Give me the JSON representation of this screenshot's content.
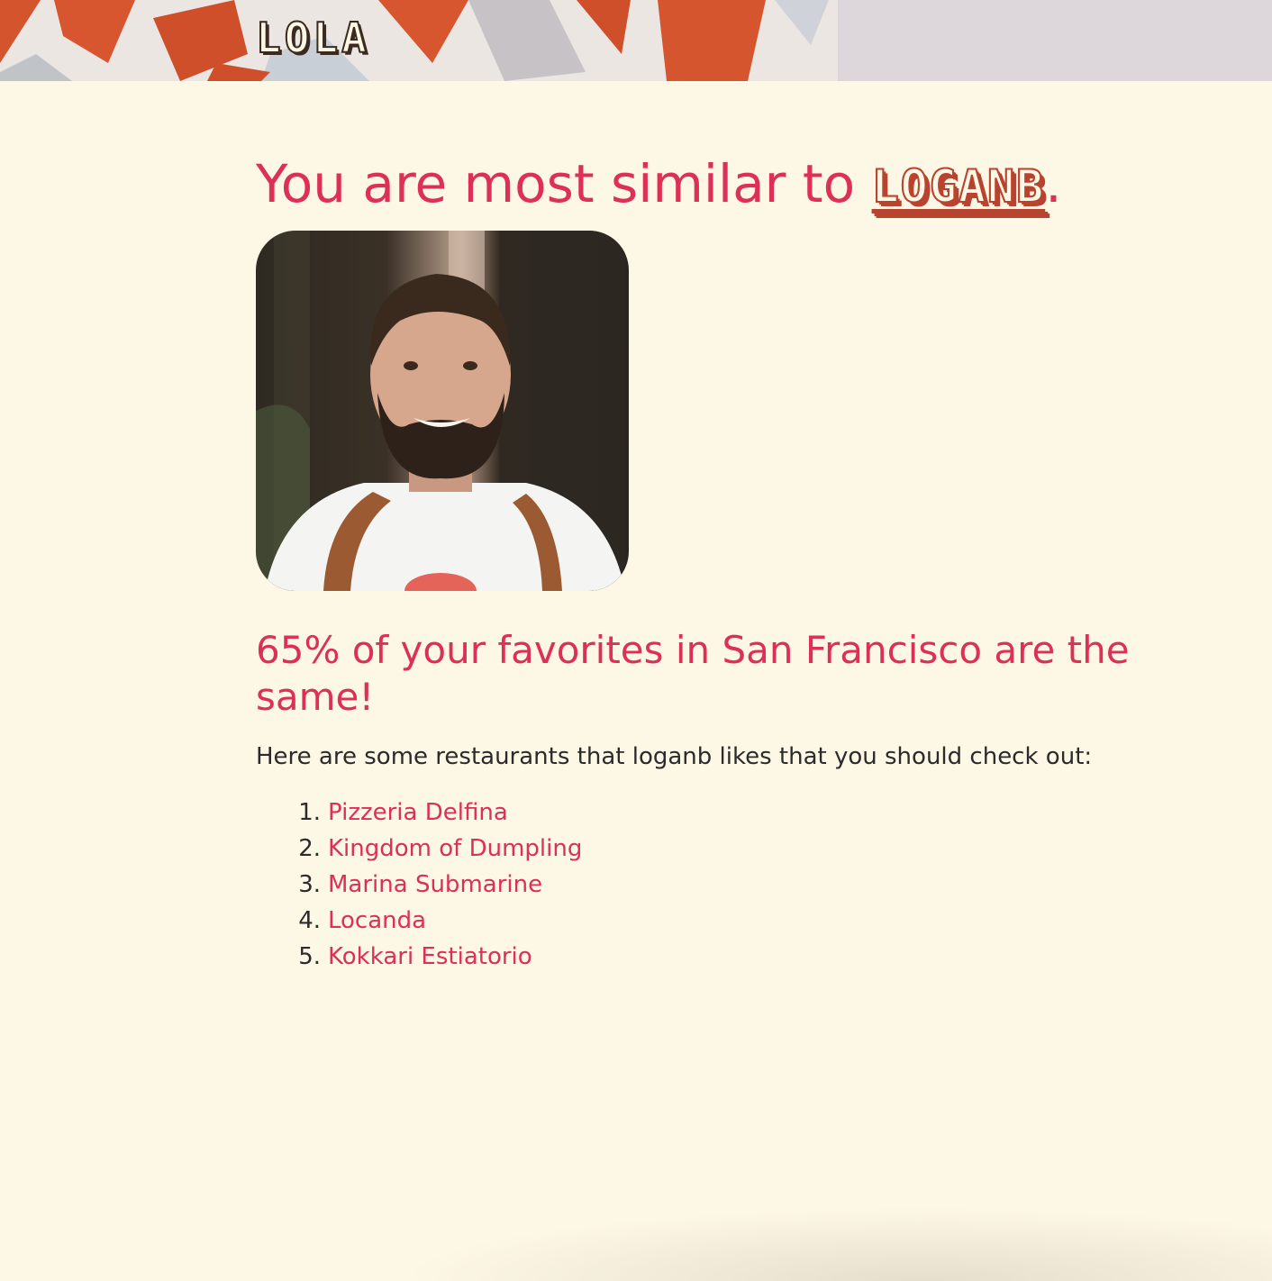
{
  "header": {
    "logo_text": "LOLA"
  },
  "result": {
    "headline_prefix": "You are most similar to ",
    "username": "LOGANB",
    "headline_suffix": ".",
    "match_text": "65% of your favorites in San Francisco are the same!",
    "match_percent": 65,
    "intro_text": "Here are some restaurants that loganb likes that you should check out:"
  },
  "restaurants": [
    {
      "num": "1.",
      "name": "Pizzeria Delfina"
    },
    {
      "num": "2.",
      "name": "Kingdom of Dumpling"
    },
    {
      "num": "3.",
      "name": "Marina Submarine"
    },
    {
      "num": "4.",
      "name": "Locanda"
    },
    {
      "num": "5.",
      "name": "Kokkari Estiatorio"
    }
  ],
  "colors": {
    "background": "#fdf7e5",
    "accent": "#dc3057",
    "username_brown": "#b8432e",
    "body_text": "#2b2b2b"
  }
}
